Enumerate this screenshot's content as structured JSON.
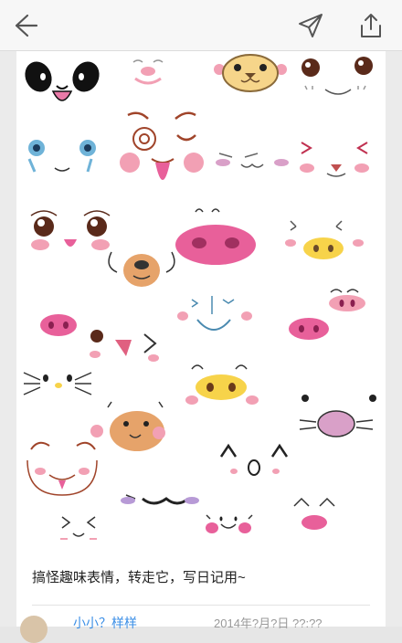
{
  "topbar": {
    "back_icon": "arrow-left-icon",
    "send_icon": "paper-plane-icon",
    "share_icon": "share-upload-icon"
  },
  "post": {
    "caption": "搞怪趣味表情，转走它，写日记用~",
    "author": "小小？样样",
    "timestamp": "2014年?月?日 ??:??"
  },
  "colors": {
    "pink_cheek": "#f2a0b4",
    "nose_pink": "#e8609a",
    "yellow_face": "#f7d34a",
    "bear_brown": "#e6a36a",
    "link_blue": "#3a8ee6"
  }
}
